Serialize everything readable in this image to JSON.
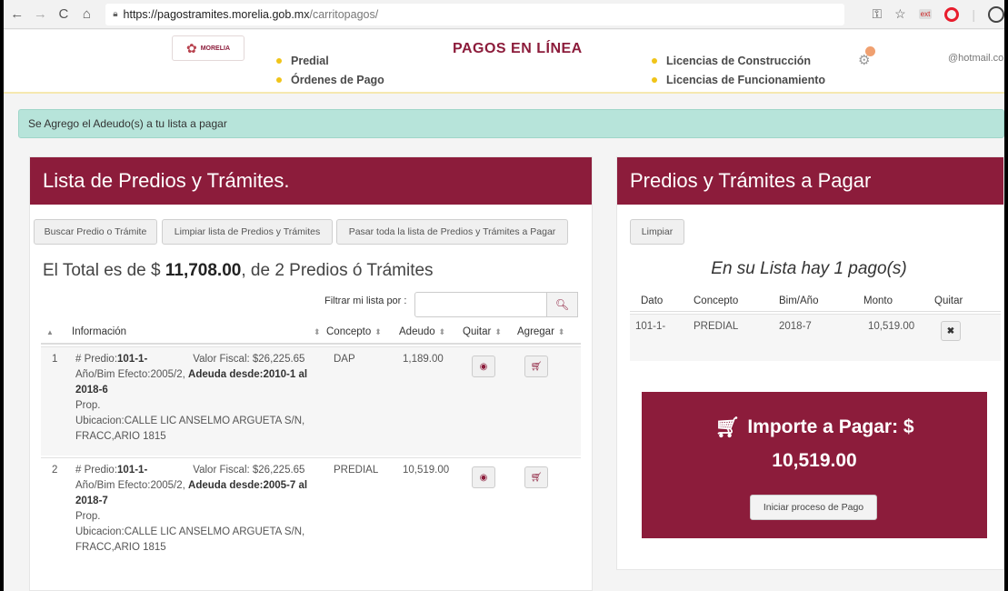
{
  "browser": {
    "back_icon": "←",
    "forward_icon": "→",
    "reload_icon": "C",
    "home_icon": "⌂",
    "url_host": "https://pagostramites.morelia.gob.mx",
    "url_path": "/carritopagos/"
  },
  "header": {
    "logo_text": "MORELIA",
    "title": "PAGOS EN LÍNEA",
    "links_left": [
      "Predial",
      "Órdenes de Pago"
    ],
    "links_right": [
      "Licencias de Construcción",
      "Licencias de Funcionamiento"
    ],
    "user_email": "@hotmail.com"
  },
  "alert": {
    "message": "Se Agrego el Adeudo(s) a tu lista a pagar"
  },
  "left_panel": {
    "title": "Lista de Predios y Trámites.",
    "buttons": {
      "search": "Buscar Predio o Trámite",
      "clear": "Limpiar lista de Predios y Trámites",
      "move_all": "Pasar toda la lista de Predios y Trámites a Pagar"
    },
    "total_prefix": "El Total es de $ ",
    "total_amount": "11,708.00",
    "total_suffix": ", de 2 Predios ó Trámites",
    "filter_label": "Filtrar mi lista por :",
    "columns": [
      "Información",
      "Concepto",
      "Adeudo",
      "Quitar",
      "Agregar"
    ],
    "rows": [
      {
        "index": "1",
        "predio_label": "# Predio:",
        "predio": "101-1-",
        "valor_fiscal": "Valor Fiscal: $26,225.65",
        "efecto": "Año/Bim Efecto:2005/2, ",
        "adeuda_desde": "Adeuda desde:2010-1 al",
        "adeuda_hasta": "2018-6",
        "prop": "Prop.",
        "ubicacion_1": "Ubicacion:CALLE LIC ANSELMO ARGUETA S/N,",
        "ubicacion_2": "FRACC,ARIO 1815",
        "concepto": "DAP",
        "adeudo": "1,189.00"
      },
      {
        "index": "2",
        "predio_label": "# Predio:",
        "predio": "101-1-",
        "valor_fiscal": "Valor Fiscal: $26,225.65",
        "efecto": "Año/Bim Efecto:2005/2, ",
        "adeuda_desde": "Adeuda desde:2005-7 al",
        "adeuda_hasta": "2018-7",
        "prop": "Prop.",
        "ubicacion_1": "Ubicacion:CALLE LIC ANSELMO ARGUETA S/N,",
        "ubicacion_2": "FRACC,ARIO 1815",
        "concepto": "PREDIAL",
        "adeudo": "10,519.00"
      }
    ]
  },
  "right_panel": {
    "title": "Predios y Trámites a Pagar",
    "clear_button": "Limpiar",
    "list_title": "En su Lista hay 1 pago(s)",
    "columns": [
      "Dato",
      "Concepto",
      "Bim/Año",
      "Monto",
      "Quitar"
    ],
    "rows": [
      {
        "dato": "101-1-",
        "concepto": "PREDIAL",
        "bim": "2018-7",
        "monto": "10,519.00"
      }
    ],
    "importe_label": "Importe a Pagar: $",
    "importe_amount": "10,519.00",
    "pay_button": "Iniciar proceso de Pago"
  },
  "colors": {
    "brand": "#8c1c3b",
    "alert_bg": "#b7e4da",
    "accent_dot": "#f0c419"
  }
}
